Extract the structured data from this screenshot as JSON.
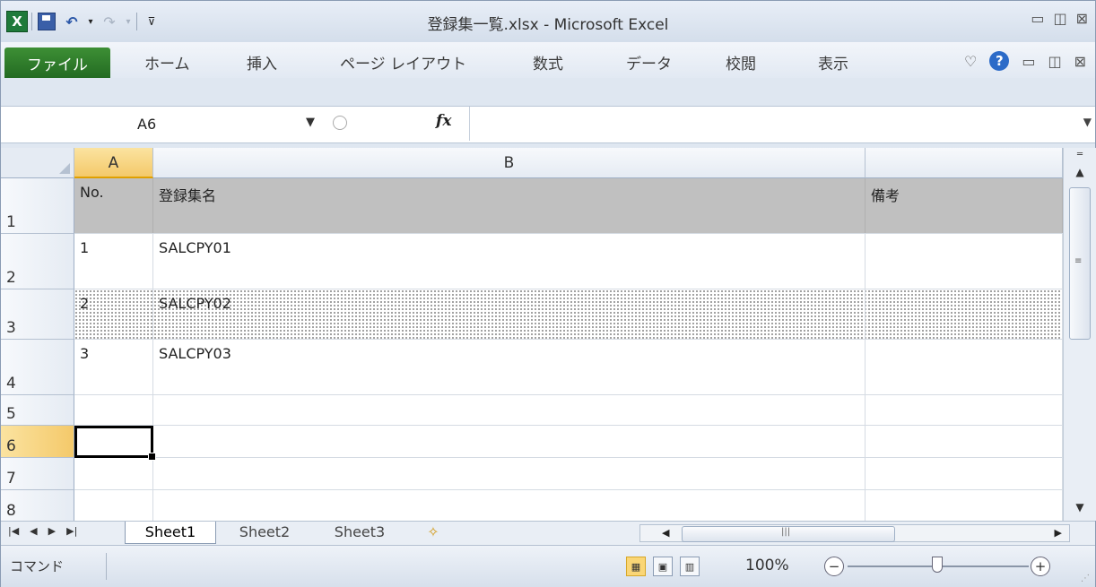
{
  "window": {
    "title": "登録集一覧.xlsx - Microsoft Excel"
  },
  "ribbon": {
    "tabs": [
      "ファイル",
      "ホーム",
      "挿入",
      "ページ レイアウト",
      "数式",
      "データ",
      "校閲",
      "表示"
    ]
  },
  "formula_bar": {
    "name_box": "A6",
    "fx_label": "fx",
    "formula": ""
  },
  "grid": {
    "columns": [
      "A",
      "B",
      ""
    ],
    "selected_cell": "A6",
    "rows": [
      {
        "num": "1",
        "a": "No.",
        "b": "登録集名",
        "c": "備考"
      },
      {
        "num": "2",
        "a": "1",
        "b": "SALCPY01",
        "c": ""
      },
      {
        "num": "3",
        "a": "2",
        "b": "SALCPY02",
        "c": ""
      },
      {
        "num": "4",
        "a": "3",
        "b": "SALCPY03",
        "c": ""
      },
      {
        "num": "5",
        "a": "",
        "b": "",
        "c": ""
      },
      {
        "num": "6",
        "a": "",
        "b": "",
        "c": ""
      },
      {
        "num": "7",
        "a": "",
        "b": "",
        "c": ""
      },
      {
        "num": "8",
        "a": "",
        "b": "",
        "c": ""
      }
    ]
  },
  "sheets": [
    "Sheet1",
    "Sheet2",
    "Sheet3"
  ],
  "status": {
    "mode": "コマンド",
    "zoom": "100%"
  },
  "colors": {
    "file_tab": "#2f7d2b",
    "selected_header": "#f4c96a",
    "header_row_fill": "#c0c0c0",
    "help_icon": "#2c6bc8"
  }
}
